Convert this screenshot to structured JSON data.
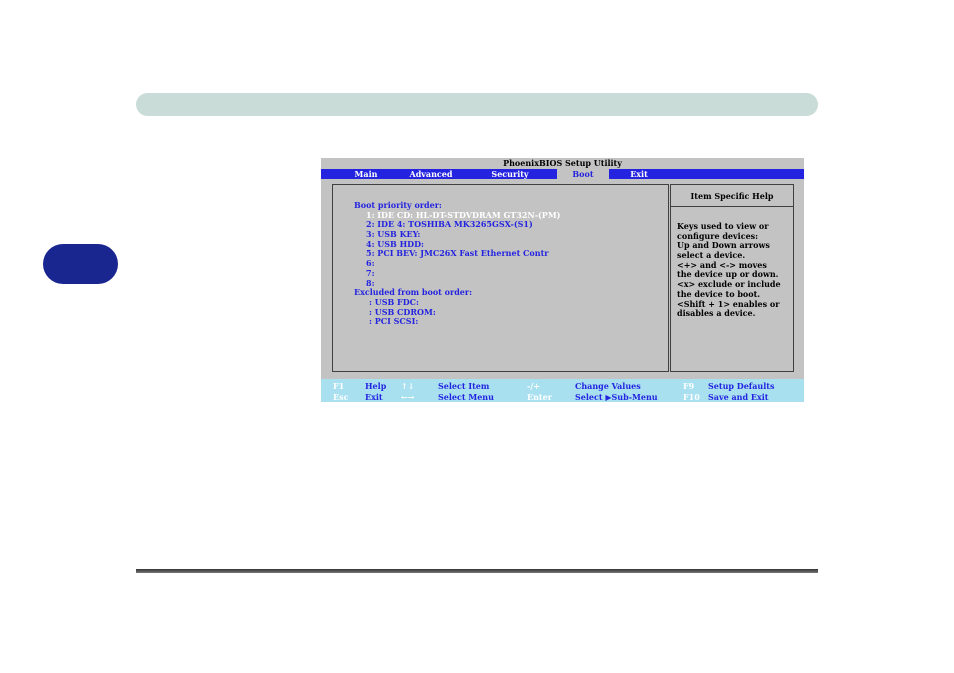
{
  "bios": {
    "title": "PhoenixBIOS Setup Utility",
    "menu": [
      "Main",
      "Advanced",
      "Security",
      "Boot",
      "Exit"
    ],
    "active_menu": "Boot",
    "boot_heading": "Boot priority order:",
    "boot_items": [
      "1: IDE CD: HL-DT-STDVDRAM GT32N-(PM)",
      "2: IDE 4: TOSHIBA MK3265GSX-(S1)",
      "3: USB KEY:",
      "4: USB HDD:",
      "5: PCI BEV: JMC26X Fast Ethernet Contr",
      "6:",
      "7:",
      "8:"
    ],
    "excluded_heading": "Excluded from boot order:",
    "excluded_items": [
      ": USB FDC:",
      ": USB CDROM:",
      ": PCI SCSI:"
    ],
    "help_title": "Item Specific Help",
    "help_lines": [
      "Keys used to view or",
      "configure devices:",
      "Up and Down arrows",
      "select a device.",
      "<+> and <-> moves",
      "the device up or down.",
      "<x> exclude or include",
      "the device to boot.",
      "<Shift + 1> enables or",
      "disables a device."
    ],
    "status_row1": {
      "k1": "F1",
      "l1": "Help",
      "k2": "↑↓",
      "l2": "Select Item",
      "k3": "-/+",
      "l3": "Change Values",
      "k4": "F9",
      "l4": "Setup Defaults"
    },
    "status_row2": {
      "k1": "Esc",
      "l1": "Exit",
      "k2": "←→",
      "l2": "Select Menu",
      "k3": "Enter",
      "l3": "Select ▶Sub-Menu",
      "k4": "F10",
      "l4": "Save and Exit"
    }
  },
  "colors": {
    "bios_blue": "#2424e0",
    "bios_gray": "#c3c3c3",
    "status_cyan": "#a8e0f0",
    "header_bar": "#c9dcd8",
    "side_tab": "#1a2690"
  }
}
